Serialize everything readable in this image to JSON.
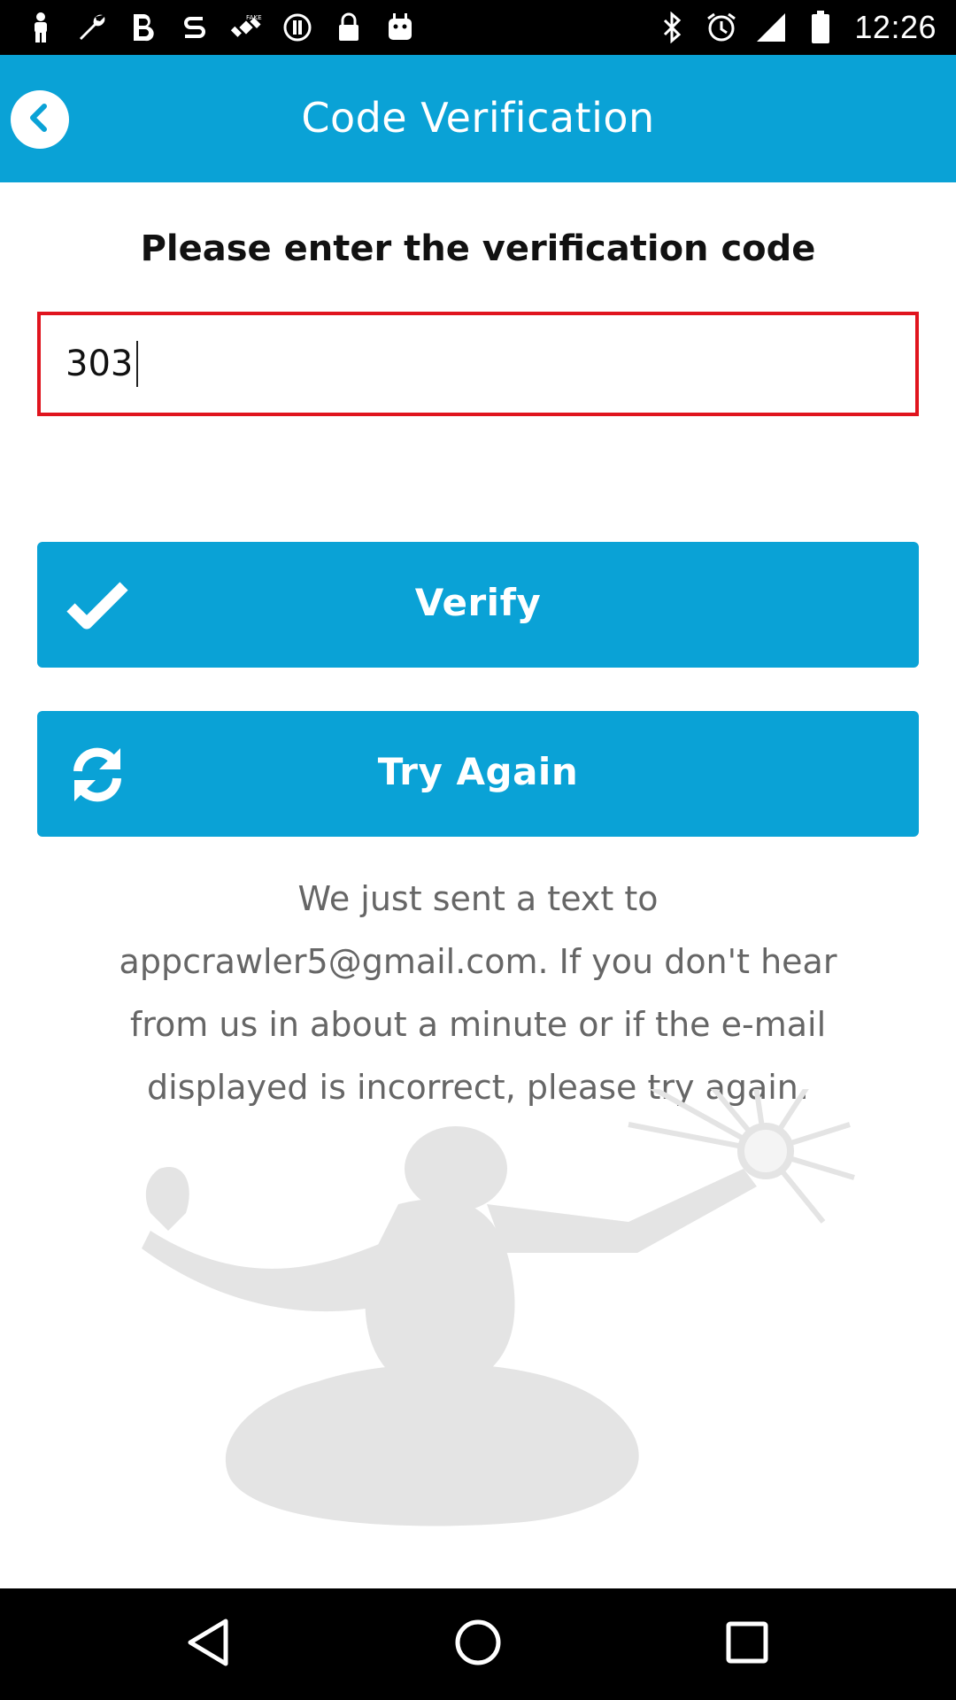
{
  "status_bar": {
    "time": "12:26",
    "left_icons": [
      "person-icon",
      "wrench-icon",
      "bold-b-icon",
      "s-app-icon",
      "fake-gps-icon",
      "info-icon",
      "lock-icon",
      "android-icon"
    ],
    "right_icons": [
      "bluetooth-icon",
      "alarm-icon",
      "signal-icon",
      "battery-icon"
    ]
  },
  "header": {
    "title": "Code Verification",
    "back_icon": "chevron-left-icon"
  },
  "form": {
    "prompt": "Please enter the verification code",
    "code_value": "303"
  },
  "buttons": {
    "verify_label": "Verify",
    "verify_icon": "checkmark-icon",
    "retry_label": "Try Again",
    "retry_icon": "refresh-icon"
  },
  "info": {
    "message": "We just sent a text to appcrawler5@gmail.com. If you don't hear from us in about a minute or if the e-mail displayed is incorrect, please try again."
  },
  "nav_bar": {
    "icons": [
      "back-triangle-icon",
      "home-circle-icon",
      "recents-square-icon"
    ]
  },
  "colors": {
    "accent": "#0aa2d6",
    "field_border": "#e0141e",
    "text_dark": "#111111",
    "text_muted": "#666666"
  }
}
